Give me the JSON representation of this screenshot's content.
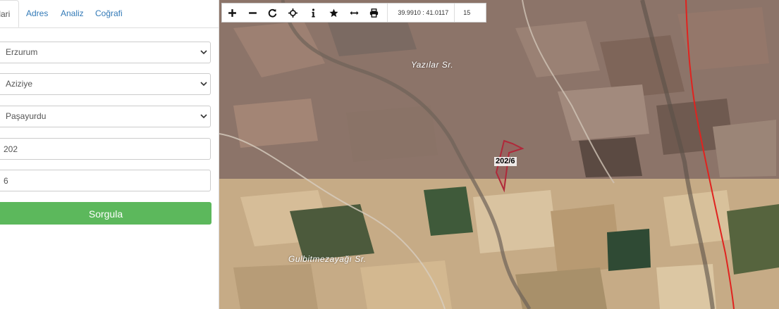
{
  "tabs": [
    {
      "label": "İdari",
      "active": true
    },
    {
      "label": "Adres",
      "active": false
    },
    {
      "label": "Analiz",
      "active": false
    },
    {
      "label": "Coğrafi",
      "active": false
    }
  ],
  "form": {
    "province": "Erzurum",
    "district": "Aziziye",
    "neighborhood": "Paşayurdu",
    "block_number": "202",
    "parcel_number": "6",
    "submit_label": "Sorgula",
    "submit_color": "#5cb85c"
  },
  "map": {
    "toolbar": {
      "icons": [
        "zoom-in-icon",
        "zoom-out-icon",
        "refresh-icon",
        "locate-icon",
        "info-icon",
        "star-icon",
        "measure-icon",
        "print-icon"
      ],
      "coordinates": "39.9910 : 41.0117",
      "zoom_level": "15"
    },
    "place_labels": [
      "Yazılar Sr.",
      "Gulbitmezayağı Sr."
    ],
    "parcel_label": "202/6",
    "parcel_outline_color": "#b0283a",
    "road_color": "#e0231f"
  }
}
